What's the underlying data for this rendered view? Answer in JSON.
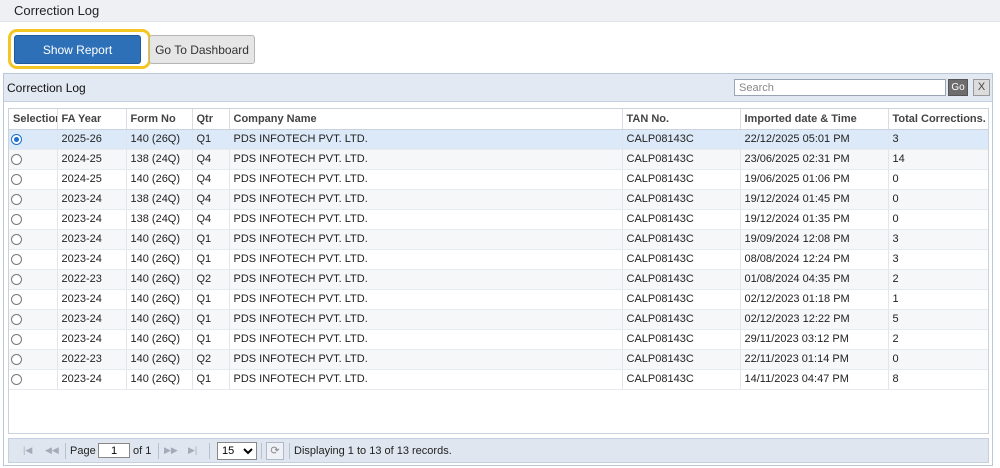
{
  "header": {
    "title": "Correction Log"
  },
  "toolbar": {
    "show_report_label": "Show Report",
    "dashboard_label": "Go To Dashboard"
  },
  "grid": {
    "caption": "Correction Log",
    "search": {
      "placeholder": "Search",
      "value": ""
    },
    "go_label": "Go",
    "close_label": "X",
    "columns": [
      "Selection",
      "FA Year",
      "Form No",
      "Qtr",
      "Company Name",
      "TAN No.",
      "Imported date & Time",
      "Total Corrections."
    ],
    "rows": [
      {
        "selected": true,
        "fa_year": "2025-26",
        "form_no": "140 (26Q)",
        "qtr": "Q1",
        "company": "PDS INFOTECH PVT. LTD.",
        "tan": "CALP08143C",
        "imported": "22/12/2025 05:01 PM",
        "total": "3"
      },
      {
        "selected": false,
        "fa_year": "2024-25",
        "form_no": "138 (24Q)",
        "qtr": "Q4",
        "company": "PDS INFOTECH PVT. LTD.",
        "tan": "CALP08143C",
        "imported": "23/06/2025 02:31 PM",
        "total": "14"
      },
      {
        "selected": false,
        "fa_year": "2024-25",
        "form_no": "140 (26Q)",
        "qtr": "Q4",
        "company": "PDS INFOTECH PVT. LTD.",
        "tan": "CALP08143C",
        "imported": "19/06/2025 01:06 PM",
        "total": "0"
      },
      {
        "selected": false,
        "fa_year": "2023-24",
        "form_no": "138 (24Q)",
        "qtr": "Q4",
        "company": "PDS INFOTECH PVT. LTD.",
        "tan": "CALP08143C",
        "imported": "19/12/2024 01:45 PM",
        "total": "0"
      },
      {
        "selected": false,
        "fa_year": "2023-24",
        "form_no": "138 (24Q)",
        "qtr": "Q4",
        "company": "PDS INFOTECH PVT. LTD.",
        "tan": "CALP08143C",
        "imported": "19/12/2024 01:35 PM",
        "total": "0"
      },
      {
        "selected": false,
        "fa_year": "2023-24",
        "form_no": "140 (26Q)",
        "qtr": "Q1",
        "company": "PDS INFOTECH PVT. LTD.",
        "tan": "CALP08143C",
        "imported": "19/09/2024 12:08 PM",
        "total": "3"
      },
      {
        "selected": false,
        "fa_year": "2023-24",
        "form_no": "140 (26Q)",
        "qtr": "Q1",
        "company": "PDS INFOTECH PVT. LTD.",
        "tan": "CALP08143C",
        "imported": "08/08/2024 12:24 PM",
        "total": "3"
      },
      {
        "selected": false,
        "fa_year": "2022-23",
        "form_no": "140 (26Q)",
        "qtr": "Q2",
        "company": "PDS INFOTECH PVT. LTD.",
        "tan": "CALP08143C",
        "imported": "01/08/2024 04:35 PM",
        "total": "2"
      },
      {
        "selected": false,
        "fa_year": "2023-24",
        "form_no": "140 (26Q)",
        "qtr": "Q1",
        "company": "PDS INFOTECH PVT. LTD.",
        "tan": "CALP08143C",
        "imported": "02/12/2023 01:18 PM",
        "total": "1"
      },
      {
        "selected": false,
        "fa_year": "2023-24",
        "form_no": "140 (26Q)",
        "qtr": "Q1",
        "company": "PDS INFOTECH PVT. LTD.",
        "tan": "CALP08143C",
        "imported": "02/12/2023 12:22 PM",
        "total": "5"
      },
      {
        "selected": false,
        "fa_year": "2023-24",
        "form_no": "140 (26Q)",
        "qtr": "Q1",
        "company": "PDS INFOTECH PVT. LTD.",
        "tan": "CALP08143C",
        "imported": "29/11/2023 03:12 PM",
        "total": "2"
      },
      {
        "selected": false,
        "fa_year": "2022-23",
        "form_no": "140 (26Q)",
        "qtr": "Q2",
        "company": "PDS INFOTECH PVT. LTD.",
        "tan": "CALP08143C",
        "imported": "22/11/2023 01:14 PM",
        "total": "0"
      },
      {
        "selected": false,
        "fa_year": "2023-24",
        "form_no": "140 (26Q)",
        "qtr": "Q1",
        "company": "PDS INFOTECH PVT. LTD.",
        "tan": "CALP08143C",
        "imported": "14/11/2023 04:47 PM",
        "total": "8"
      }
    ]
  },
  "pager": {
    "page_label": "Page",
    "page_value": "1",
    "of_label": "of 1",
    "page_size": "15",
    "page_size_options": [
      "15"
    ],
    "status": "Displaying 1 to 13 of 13 records.",
    "icons": [
      "first-page-icon",
      "prev-page-icon",
      "next-page-icon",
      "last-page-icon",
      "refresh-icon"
    ]
  },
  "colors": {
    "primary": "#2e70b8",
    "highlight": "#f3c623",
    "selected_row": "#dce9f8"
  }
}
